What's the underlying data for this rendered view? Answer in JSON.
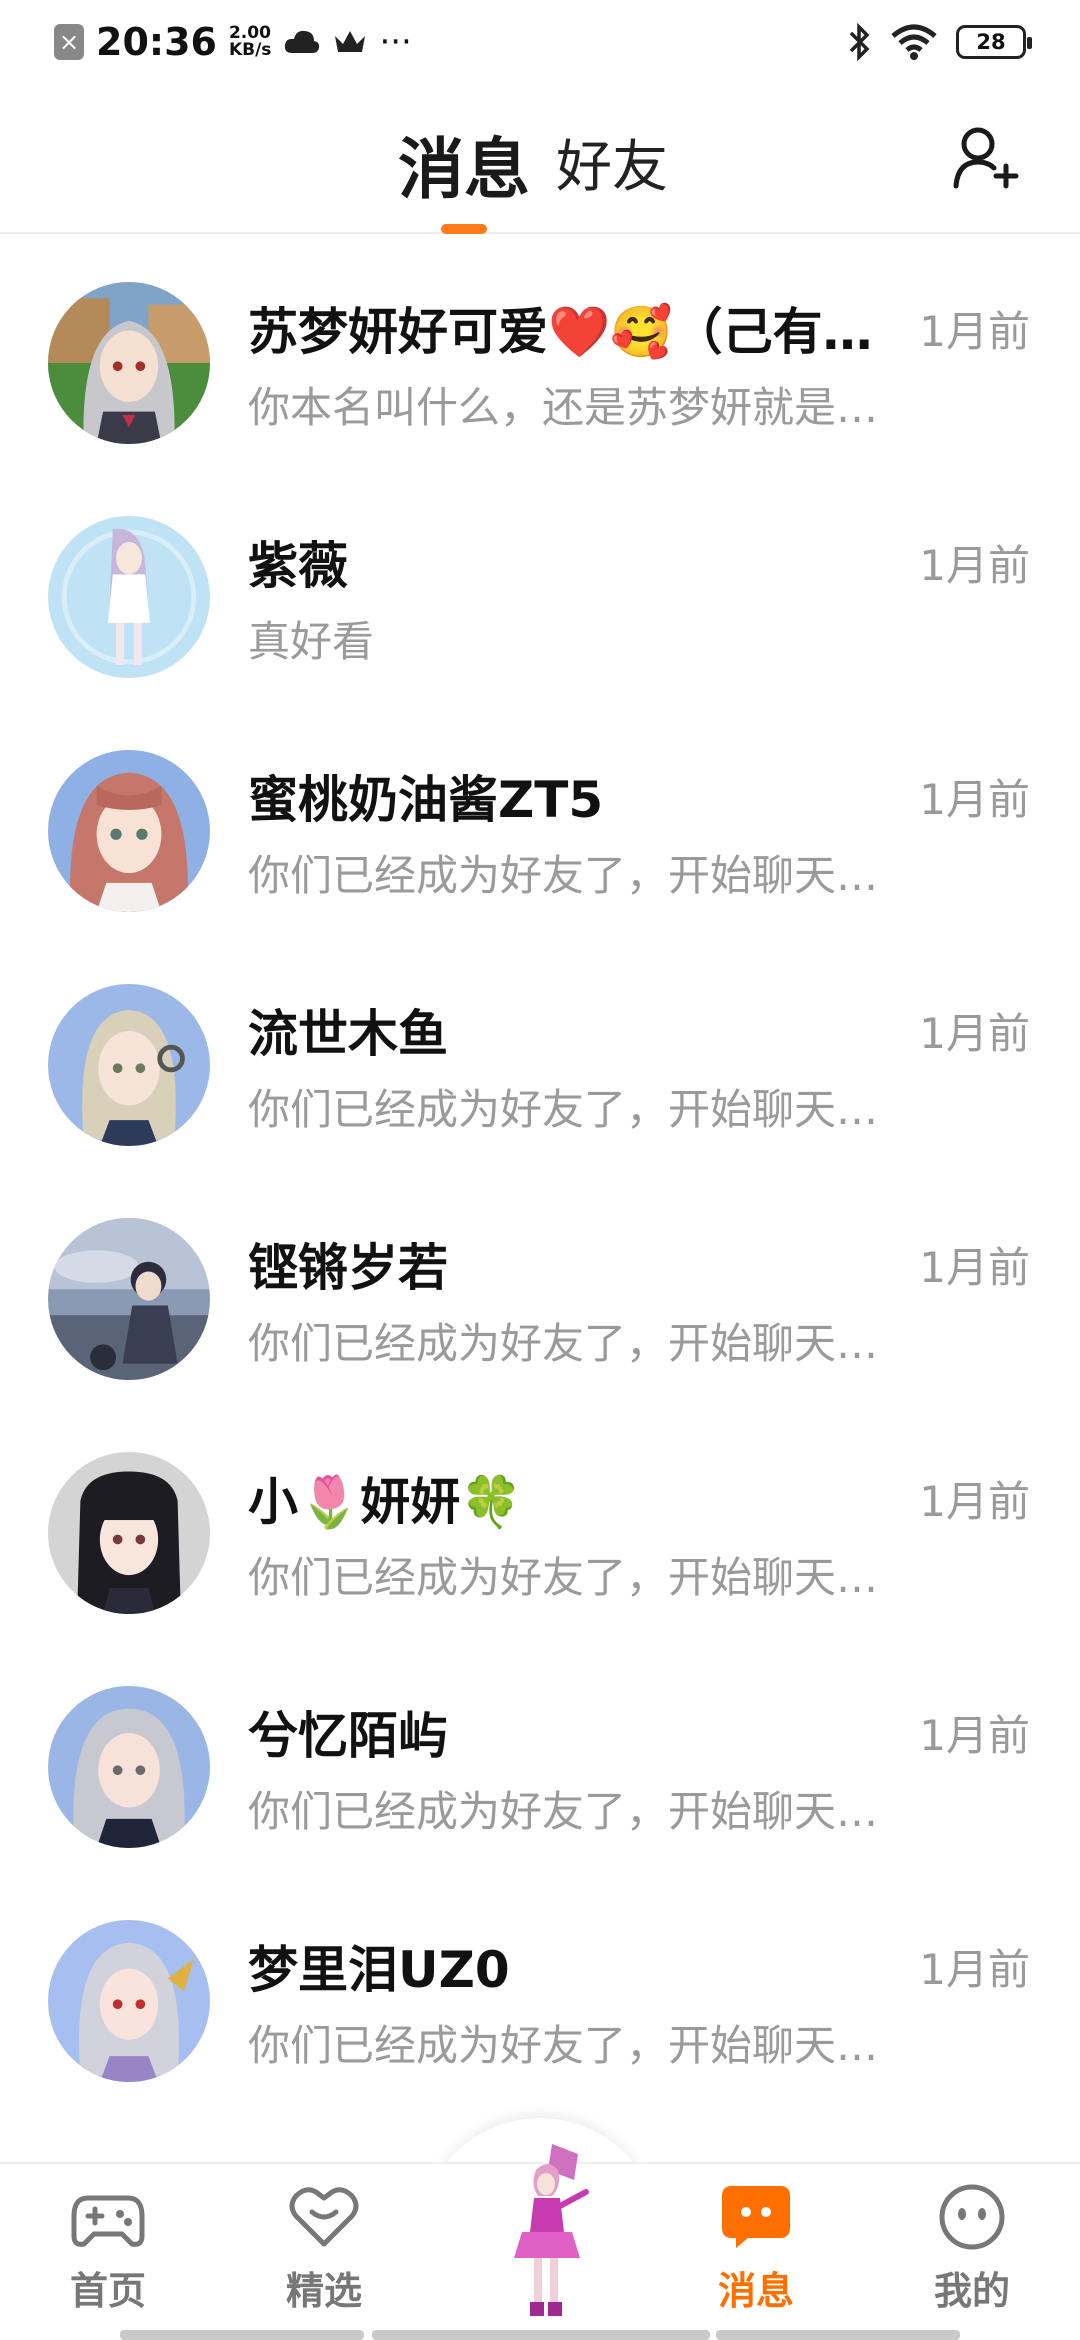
{
  "status_bar": {
    "time": "20:36",
    "speed_value": "2.00",
    "speed_unit": "KB/s",
    "more": "···",
    "battery": "28"
  },
  "header": {
    "tab_messages": "消息",
    "tab_friends": "好友",
    "accent_color": "#ff7a1a"
  },
  "messages": [
    {
      "name": "苏梦妍好可爱❤️🥰（己有…",
      "preview": "你本名叫什么，还是苏梦妍就是…",
      "time": "1月前"
    },
    {
      "name": "紫薇",
      "preview": "真好看",
      "time": "1月前"
    },
    {
      "name": "蜜桃奶油酱ZT5",
      "preview": "你们已经成为好友了，开始聊天…",
      "time": "1月前"
    },
    {
      "name": "流世木鱼",
      "preview": "你们已经成为好友了，开始聊天…",
      "time": "1月前"
    },
    {
      "name": "铿锵岁若",
      "preview": "你们已经成为好友了，开始聊天…",
      "time": "1月前"
    },
    {
      "name": "小🌷妍妍🍀",
      "preview": "你们已经成为好友了，开始聊天…",
      "time": "1月前"
    },
    {
      "name": "兮忆陌屿",
      "preview": "你们已经成为好友了，开始聊天…",
      "time": "1月前"
    },
    {
      "name": "梦里泪UZ0",
      "preview": "你们已经成为好友了，开始聊天…",
      "time": "1月前"
    }
  ],
  "nav": {
    "home": "首页",
    "featured": "精选",
    "messages": "消息",
    "profile": "我的",
    "active_color": "#ff6f00"
  }
}
